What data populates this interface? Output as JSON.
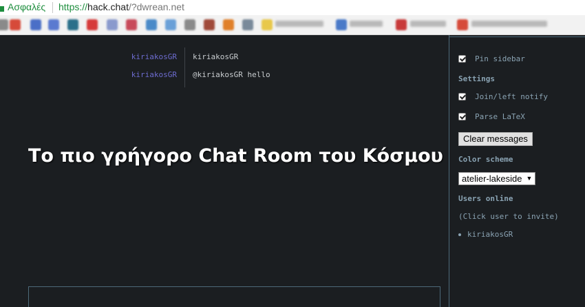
{
  "browser": {
    "secure_label": "Ασφαλές",
    "url_scheme": "https://",
    "url_host": "hack.chat",
    "url_path": "/?dwrean.net"
  },
  "chat": {
    "messages": [
      {
        "nick": "kiriakosGR",
        "text": "kiriakosGR"
      },
      {
        "nick": "kiriakosGR",
        "text": "@kiriakosGR hello"
      }
    ],
    "overlay_heading": "Το πιο γρήγορο Chat Room του Κόσμου"
  },
  "sidebar": {
    "pin_sidebar_label": "Pin sidebar",
    "settings_heading": "Settings",
    "join_left_notify_label": "Join/left notify",
    "parse_latex_label": "Parse LaTeX",
    "clear_messages_label": "Clear messages",
    "color_scheme_heading": "Color scheme",
    "color_scheme_value": "atelier-lakeside",
    "users_online_heading": "Users online",
    "invite_hint": "(Click user to invite)",
    "users": [
      "kiriakosGR"
    ]
  },
  "colors": {
    "nick": "#6d6ccf",
    "sidebar_text": "#8aa3b3",
    "border": "#4d6a7a",
    "background": "#1b1e21"
  }
}
